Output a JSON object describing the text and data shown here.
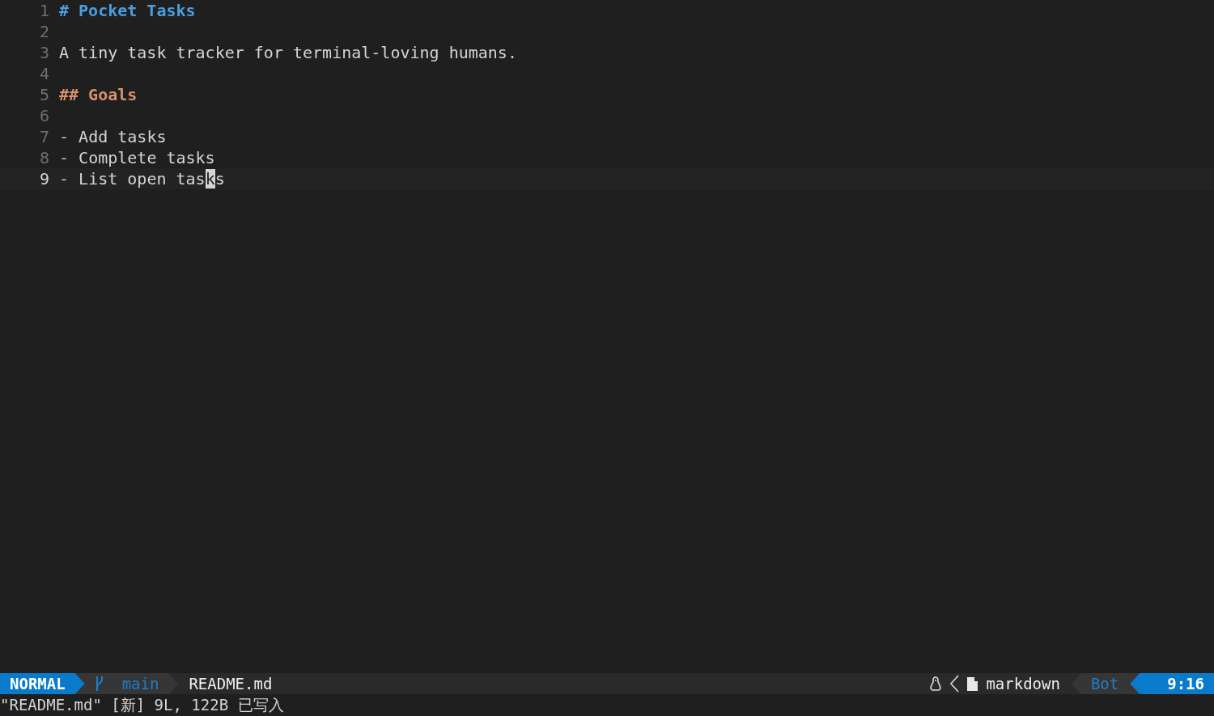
{
  "editor": {
    "lines": [
      {
        "number": "1",
        "current": false,
        "parts": [
          {
            "kind": "heading1",
            "text": "# Pocket Tasks"
          }
        ]
      },
      {
        "number": "2",
        "current": false
      },
      {
        "number": "3",
        "current": false,
        "parts": [
          {
            "kind": "text",
            "text": "A tiny task tracker for terminal-loving humans."
          }
        ]
      },
      {
        "number": "4",
        "current": false
      },
      {
        "number": "5",
        "current": false,
        "parts": [
          {
            "kind": "heading2",
            "text": "## Goals"
          }
        ]
      },
      {
        "number": "6",
        "current": false
      },
      {
        "number": "7",
        "current": false,
        "parts": [
          {
            "kind": "bullet",
            "text": "-"
          },
          {
            "kind": "text",
            "text": " Add tasks"
          }
        ]
      },
      {
        "number": "8",
        "current": false,
        "parts": [
          {
            "kind": "bullet",
            "text": "-"
          },
          {
            "kind": "text",
            "text": " Complete tasks"
          }
        ]
      },
      {
        "number": "9",
        "current": true,
        "parts": [
          {
            "kind": "bullet",
            "text": "-"
          },
          {
            "kind": "text",
            "text": " List open tas"
          },
          {
            "kind": "cursor",
            "text": "k"
          },
          {
            "kind": "text",
            "text": "s"
          }
        ]
      }
    ]
  },
  "status_bar": {
    "mode": "NORMAL",
    "branch": "main",
    "file": "README.md",
    "filetype": "markdown",
    "scroll_position": "Bot",
    "cursor_position": "9:16"
  },
  "command_line": {
    "message": "\"README.md\" [新] 9L, 122B 已写入"
  }
}
